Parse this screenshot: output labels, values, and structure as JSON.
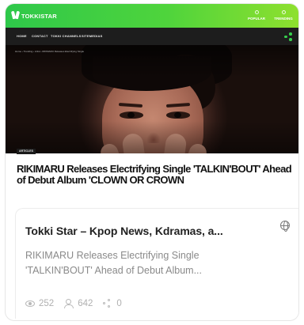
{
  "site": {
    "logo_text": "TOKKISTAR",
    "header_links": [
      "POPULAR",
      "TRENDING"
    ],
    "nav_items": [
      "HOME",
      "CONTACT",
      "TOKKI CHANNELS",
      "SITEMEDIAS"
    ],
    "breadcrumb": "Home › Trending › Artist › RIKIMARU Releases Electrifying Single",
    "article_tag": "ARTICLES",
    "article_title": "RIKIMARU Releases Electrifying Single 'TALKIN'BOUT' Ahead of Debut Album 'CLOWN OR CROWN"
  },
  "preview": {
    "site_name": "Tokki Star – Kpop News, Kdramas, a...",
    "description_line1": "RIKIMARU Releases Electrifying Single",
    "description_line2": "'TALKIN'BOUT' Ahead of Debut Album...",
    "stats": {
      "views": "252",
      "users": "642",
      "shares": "0"
    }
  },
  "colors": {
    "header_green": "#3ccf46",
    "nav_dark": "#1d1d1d",
    "title_text": "#111111",
    "muted_text": "#8a8a8a",
    "stat_text": "#b0b0b0"
  }
}
